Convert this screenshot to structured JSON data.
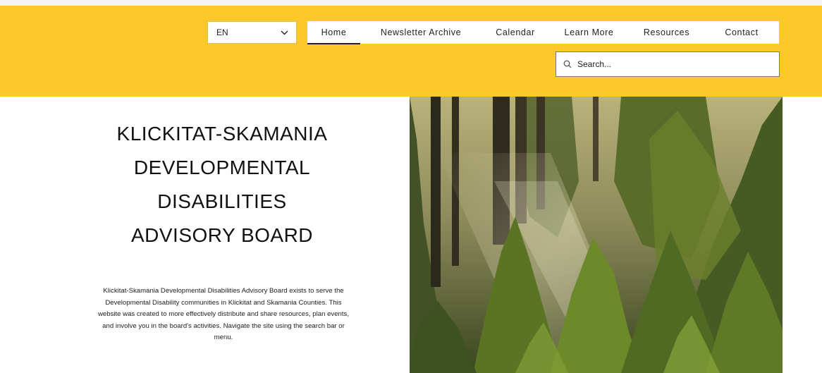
{
  "language_select": {
    "value": "EN"
  },
  "nav": {
    "items": [
      {
        "label": "Home",
        "active": true
      },
      {
        "label": "Newsletter Archive",
        "active": false
      },
      {
        "label": "Calendar",
        "active": false
      },
      {
        "label": "Learn More",
        "active": false
      },
      {
        "label": "Resources",
        "active": false
      },
      {
        "label": "Contact",
        "active": false
      }
    ]
  },
  "search": {
    "placeholder": "Search..."
  },
  "hero": {
    "title_lines": [
      "KLICKITAT-SKAMANIA",
      "DEVELOPMENTAL",
      "DISABILITIES",
      "ADVISORY BOARD"
    ],
    "description": "Klickitat-Skamania Developmental Disabilities Advisory Board exists to serve the Developmental Disability communities in Klickitat and Skamania Counties. This website was created to more effectively distribute and share resources, plan events, and involve you in the board's activities. Navigate the site using the search bar or menu."
  },
  "colors": {
    "header_bg": "#fcc929",
    "text": "#111111",
    "page_bg": "#ffffff"
  },
  "icons": {
    "language_dropdown": "chevron-down-icon",
    "search": "search-icon"
  }
}
